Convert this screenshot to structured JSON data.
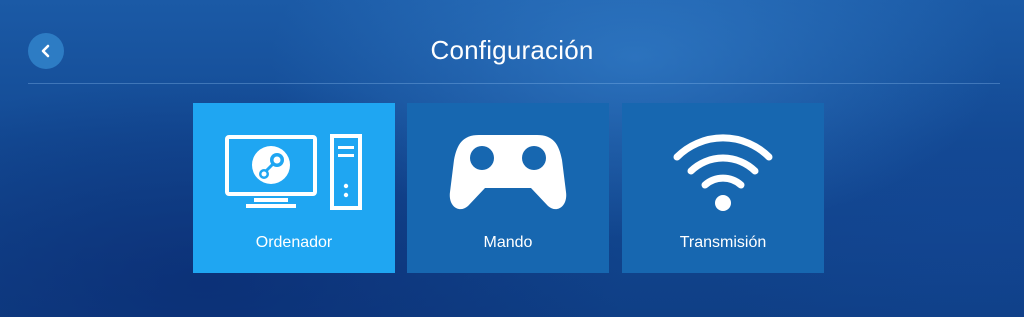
{
  "header": {
    "title": "Configuración",
    "back_icon": "chevron-left-icon"
  },
  "tiles": [
    {
      "label": "Ordenador",
      "icon": "computer-icon",
      "selected": true
    },
    {
      "label": "Mando",
      "icon": "gamepad-icon",
      "selected": false
    },
    {
      "label": "Transmisión",
      "icon": "wifi-icon",
      "selected": false
    }
  ],
  "colors": {
    "background": "#134a94",
    "tile": "#1767b0",
    "tile_selected": "#1fa6f2",
    "back_button": "#2d7cc4",
    "text": "#ffffff"
  }
}
